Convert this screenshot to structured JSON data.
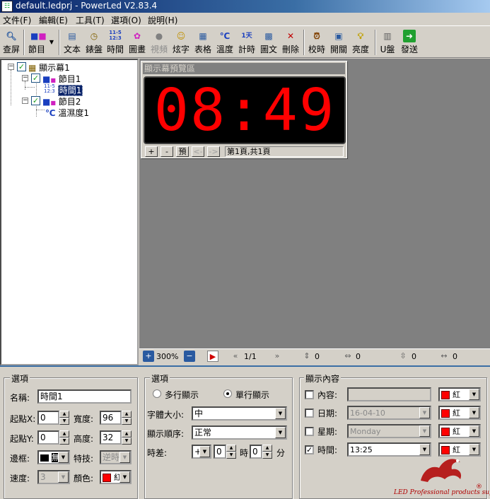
{
  "window": {
    "title": "default.ledprj - PowerLed V2.83.4"
  },
  "menu": [
    "文件(F)",
    "編輯(E)",
    "工具(T)",
    "選項(O)",
    "說明(H)"
  ],
  "toolbar": {
    "items": [
      {
        "label": "查屏",
        "icon": "search-screen-icon"
      },
      {
        "label": "節目",
        "icon": "program-icon"
      },
      {
        "label": "文本",
        "icon": "text-icon"
      },
      {
        "label": "錶盤",
        "icon": "clock-icon"
      },
      {
        "label": "時間",
        "icon": "time-icon",
        "icon_text": "11-5\n12:3"
      },
      {
        "label": "圖畫",
        "icon": "picture-icon"
      },
      {
        "label": "視頻",
        "icon": "video-icon"
      },
      {
        "label": "炫字",
        "icon": "smiley-icon"
      },
      {
        "label": "表格",
        "icon": "table-icon"
      },
      {
        "label": "溫度",
        "icon": "temperature-icon",
        "icon_text": "℃"
      },
      {
        "label": "計時",
        "icon": "timer-icon",
        "icon_text": "1天"
      },
      {
        "label": "圖文",
        "icon": "image-text-icon"
      },
      {
        "label": "刪除",
        "icon": "delete-icon",
        "icon_text": "✕"
      },
      {
        "label": "校時",
        "icon": "alarm-clock-icon"
      },
      {
        "label": "開關",
        "icon": "power-switch-icon"
      },
      {
        "label": "亮度",
        "icon": "lightbulb-icon"
      },
      {
        "label": "U盤",
        "icon": "usb-drive-icon"
      },
      {
        "label": "發送",
        "icon": "send-arrow-icon"
      }
    ]
  },
  "tree": {
    "root": "顯示幕1",
    "program1": "節目1",
    "time1": "時間1",
    "time_icon_text": "11-5\n12:3",
    "program2": "節目2",
    "temp1": "溫濕度1",
    "temp_icon_text": "℃"
  },
  "preview": {
    "title": "顯示幕預覽區",
    "clock": "08:49",
    "buttons": [
      "+",
      "-",
      "預",
      "<-",
      "->"
    ],
    "page_info": "第1頁,共1頁"
  },
  "zoombar": {
    "zoom": "300%",
    "page": "1/1",
    "v1": "0",
    "v2": "0",
    "v3": "0",
    "v4": "0"
  },
  "options": {
    "group_title": "選項",
    "name_label": "名稱:",
    "name_value": "時間1",
    "x_label": "起點X:",
    "x_value": "0",
    "width_label": "寬度:",
    "width_value": "96",
    "y_label": "起點Y:",
    "y_value": "0",
    "height_label": "高度:",
    "height_value": "32",
    "border_label": "邊框:",
    "border_value": "無",
    "effect_label": "特技:",
    "effect_value": "逆時",
    "speed_label": "速度:",
    "speed_value": "3",
    "color_label": "顏色:",
    "color_value": "紅"
  },
  "options2": {
    "group_title": "選項",
    "multi_line": "多行顯示",
    "single_line": "單行顯示",
    "font_size_label": "字體大小:",
    "font_size_value": "中",
    "order_label": "顯示順序:",
    "order_value": "正常",
    "tz_label": "時差:",
    "tz_sign": "+",
    "tz_hours": "0",
    "tz_hour_unit": "時",
    "tz_minutes": "0",
    "tz_minute_unit": "分"
  },
  "display_content": {
    "group_title": "顯示內容",
    "content_label": "內容:",
    "content_value": "",
    "content_color": "紅",
    "date_label": "日期:",
    "date_value": "16-04-10",
    "date_color": "紅",
    "week_label": "星期:",
    "week_value": "Monday",
    "week_color": "紅",
    "time_label": "時間:",
    "time_value": "13:25",
    "time_color": "紅"
  },
  "logo": {
    "text": "LED Professional products suppliers",
    "mark": "®"
  },
  "colors": {
    "led_red": "#ff0000",
    "title_blue": "#0a246a",
    "panel": "#d4d0c8"
  }
}
